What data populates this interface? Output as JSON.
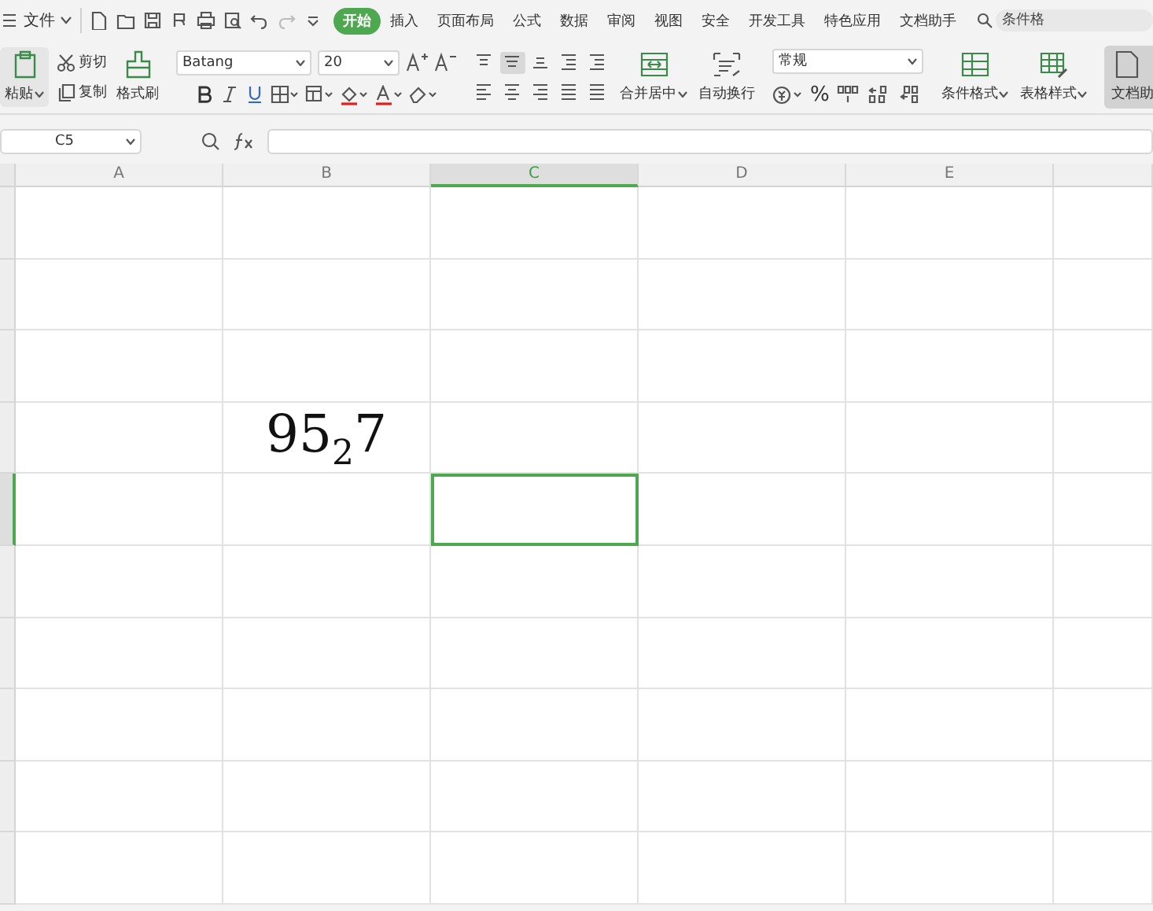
{
  "menu_bar": {
    "file_menu": "文件",
    "tabs": [
      {
        "label": "开始",
        "selected": true
      },
      {
        "label": "插入",
        "selected": false
      },
      {
        "label": "页面布局",
        "selected": false
      },
      {
        "label": "公式",
        "selected": false
      },
      {
        "label": "数据",
        "selected": false
      },
      {
        "label": "审阅",
        "selected": false
      },
      {
        "label": "视图",
        "selected": false
      },
      {
        "label": "安全",
        "selected": false
      },
      {
        "label": "开发工具",
        "selected": false
      },
      {
        "label": "特色应用",
        "selected": false
      },
      {
        "label": "文档助手",
        "selected": false
      }
    ],
    "search": {
      "placeholder": "条件格"
    }
  },
  "ribbon": {
    "paste": "粘贴",
    "cut": "剪切",
    "copy": "复制",
    "format_painter": "格式刷",
    "font": {
      "name": "Batang",
      "size": "20"
    },
    "alignment": [
      {
        "selected": false
      },
      {
        "selected": true
      },
      {
        "selected": false
      },
      {
        "selected": false
      },
      {
        "selected": false
      },
      {
        "selected": false
      },
      {
        "selected": false
      },
      {
        "selected": false
      },
      {
        "selected": false
      },
      {
        "selected": false
      }
    ],
    "merge": "合并居中",
    "wrap": "自动换行",
    "number_format": "常规",
    "percent": "%",
    "conditional_format": "条件格式",
    "table_style": "表格样式",
    "doc_helper": {
      "label": "文档助",
      "selected": true
    }
  },
  "formula_bar": {
    "name_box": "C5"
  },
  "sheet": {
    "columns": [
      {
        "label": "A",
        "selected": false
      },
      {
        "label": "B",
        "selected": false
      },
      {
        "label": "C",
        "selected": true
      },
      {
        "label": "D",
        "selected": false
      },
      {
        "label": "E",
        "selected": false
      },
      {
        "selected": false
      }
    ],
    "rows": [
      {
        "selected": false,
        "cells": [
          {
            "selected": false
          },
          {
            "selected": false
          },
          {
            "selected": false
          },
          {
            "selected": false
          },
          {
            "selected": false
          },
          {
            "selected": false
          }
        ]
      },
      {
        "selected": false,
        "cells": [
          {
            "selected": false
          },
          {
            "selected": false
          },
          {
            "selected": false
          },
          {
            "selected": false
          },
          {
            "selected": false
          },
          {
            "selected": false
          }
        ]
      },
      {
        "selected": false,
        "cells": [
          {
            "selected": false
          },
          {
            "selected": false
          },
          {
            "selected": false
          },
          {
            "selected": false
          },
          {
            "selected": false
          },
          {
            "selected": false
          }
        ]
      },
      {
        "selected": false,
        "cells": [
          {
            "selected": false
          },
          {
            "selected": false,
            "text": "95$_{2}$7"
          },
          {
            "selected": false
          },
          {
            "selected": false
          },
          {
            "selected": false
          },
          {
            "selected": false
          }
        ]
      },
      {
        "selected": true,
        "cells": [
          {
            "selected": false
          },
          {
            "selected": false
          },
          {
            "selected": true
          },
          {
            "selected": false
          },
          {
            "selected": false
          },
          {
            "selected": false
          }
        ]
      },
      {
        "selected": false,
        "cells": [
          {
            "selected": false
          },
          {
            "selected": false
          },
          {
            "selected": false
          },
          {
            "selected": false
          },
          {
            "selected": false
          },
          {
            "selected": false
          }
        ]
      },
      {
        "selected": false,
        "cells": [
          {
            "selected": false
          },
          {
            "selected": false
          },
          {
            "selected": false
          },
          {
            "selected": false
          },
          {
            "selected": false
          },
          {
            "selected": false
          }
        ]
      },
      {
        "selected": false,
        "cells": [
          {
            "selected": false
          },
          {
            "selected": false
          },
          {
            "selected": false
          },
          {
            "selected": false
          },
          {
            "selected": false
          },
          {
            "selected": false
          }
        ]
      },
      {
        "selected": false,
        "cells": [
          {
            "selected": false
          },
          {
            "selected": false
          },
          {
            "selected": false
          },
          {
            "selected": false
          },
          {
            "selected": false
          },
          {
            "selected": false
          }
        ]
      },
      {
        "selected": false,
        "cells": [
          {
            "selected": false
          },
          {
            "selected": false
          },
          {
            "selected": false
          },
          {
            "selected": false
          },
          {
            "selected": false
          },
          {
            "selected": false
          }
        ]
      }
    ]
  }
}
